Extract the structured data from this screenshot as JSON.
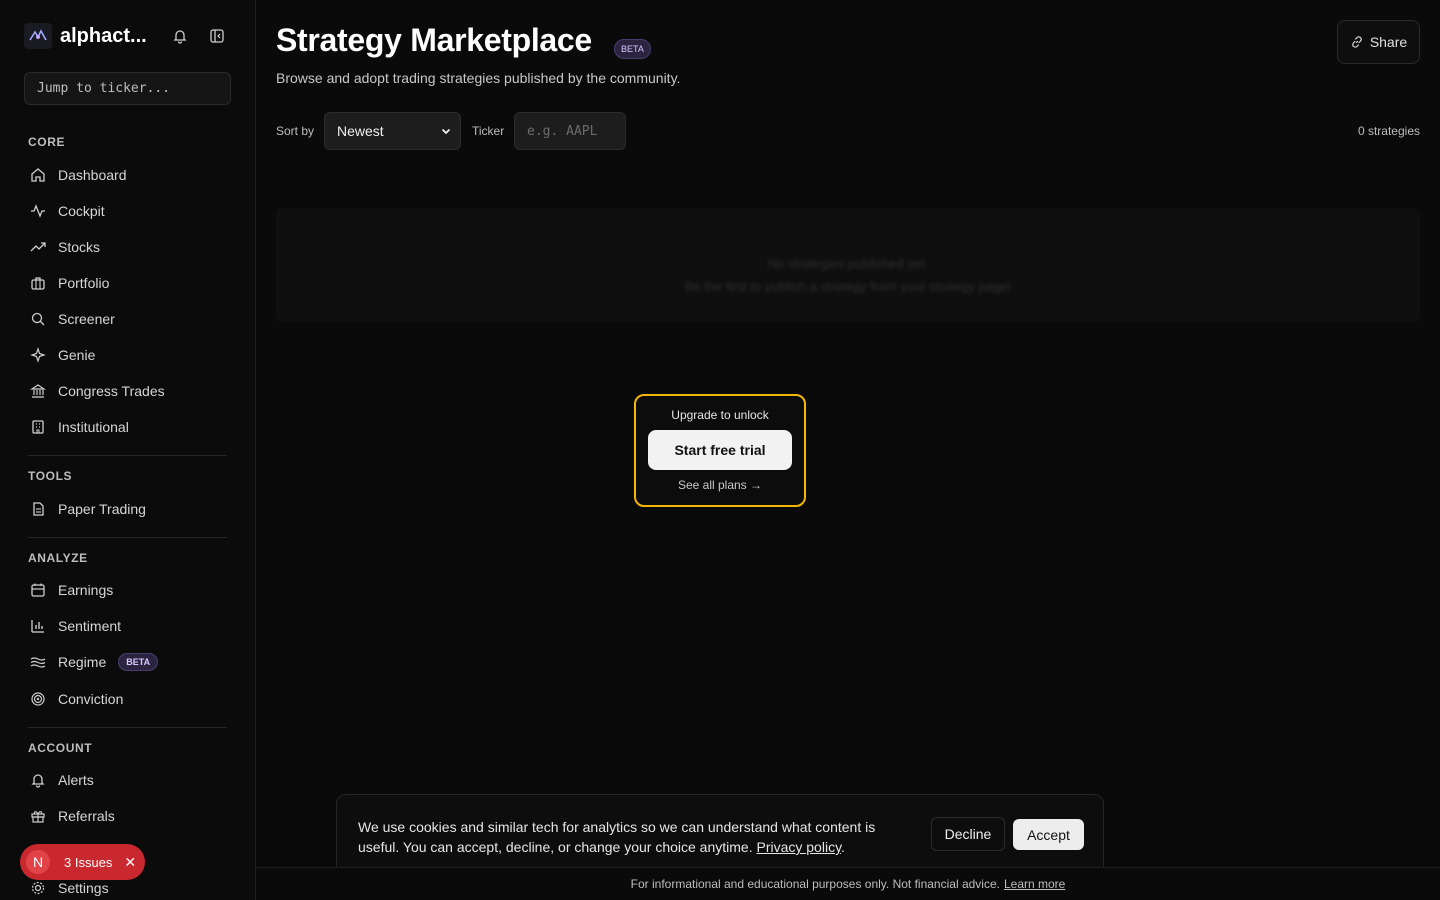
{
  "sidebar": {
    "brand_name": "alphact...",
    "jump_placeholder": "Jump to ticker...",
    "sections": {
      "core": "CORE",
      "tools": "TOOLS",
      "analyze": "ANALYZE",
      "account": "ACCOUNT"
    },
    "core_items": [
      "Dashboard",
      "Cockpit",
      "Stocks",
      "Portfolio",
      "Screener",
      "Genie",
      "Congress Trades",
      "Institutional"
    ],
    "tools_items": [
      "Paper Trading"
    ],
    "analyze_items": [
      "Earnings",
      "Sentiment",
      "Regime",
      "Conviction"
    ],
    "regime_badge": "BETA",
    "account_items": [
      "Alerts",
      "Referrals",
      "Settings"
    ],
    "issues": {
      "avatar": "N",
      "label": "3 Issues",
      "close": "✕"
    }
  },
  "header": {
    "title": "Strategy Marketplace",
    "badge": "BETA",
    "subtitle": "Browse and adopt trading strategies published by the community.",
    "share_label": "Share"
  },
  "filters": {
    "sort_label": "Sort by",
    "sort_value": "Newest",
    "ticker_label": "Ticker",
    "ticker_placeholder": "e.g. AAPL",
    "count": "0 strategies"
  },
  "empty_state": {
    "line1": "No strategies published yet.",
    "line2": "Be the first to publish a strategy from your strategy page!"
  },
  "upgrade": {
    "heading": "Upgrade to unlock",
    "button": "Start free trial",
    "link": "See all plans →",
    "border_color": "#f2b705"
  },
  "cookie": {
    "text": "We use cookies and similar tech for analytics so we can understand what content is useful. You can accept, decline, or change your choice anytime.",
    "link": "Privacy policy",
    "decline": "Decline",
    "accept": "Accept"
  },
  "footer": {
    "text": "For informational and educational purposes only. Not financial advice.",
    "link": "Learn more"
  }
}
